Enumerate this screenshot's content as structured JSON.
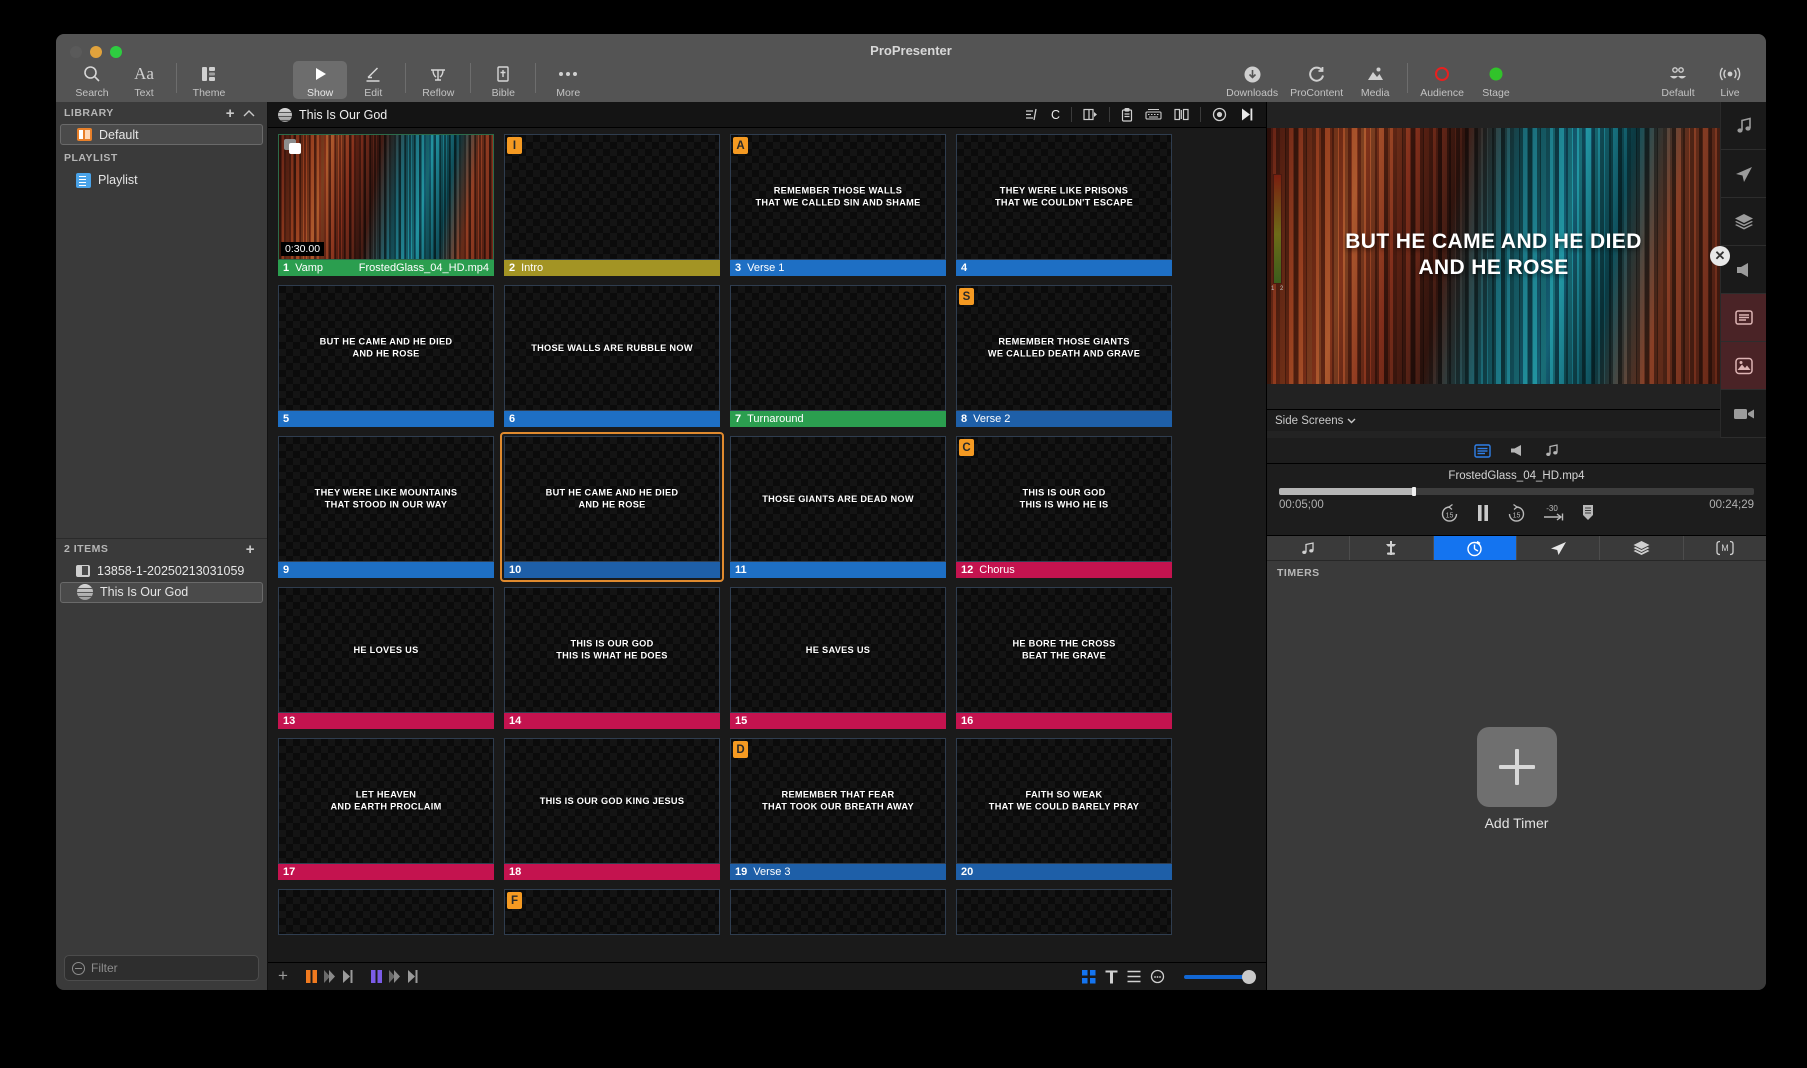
{
  "window": {
    "title": "ProPresenter"
  },
  "toolbar": {
    "left": [
      {
        "name": "search",
        "label": "Search",
        "icon": "search-icon"
      },
      {
        "name": "text",
        "label": "Text",
        "icon": "text-icon"
      },
      {
        "name": "theme",
        "label": "Theme",
        "icon": "theme-icon"
      }
    ],
    "center": [
      {
        "name": "show",
        "label": "Show",
        "icon": "play-icon",
        "active": true
      },
      {
        "name": "edit",
        "label": "Edit",
        "icon": "pencil-icon"
      },
      {
        "name": "reflow",
        "label": "Reflow",
        "icon": "reflow-icon"
      },
      {
        "name": "bible",
        "label": "Bible",
        "icon": "bible-icon"
      },
      {
        "name": "more",
        "label": "More",
        "icon": "ellipsis-icon"
      }
    ],
    "right": [
      {
        "name": "downloads",
        "label": "Downloads",
        "icon": "download-icon"
      },
      {
        "name": "procontent",
        "label": "ProContent",
        "icon": "refresh-icon"
      },
      {
        "name": "media",
        "label": "Media",
        "icon": "image-icon"
      },
      {
        "name": "audience",
        "label": "Audience",
        "icon": "circle-outline-icon"
      },
      {
        "name": "stage",
        "label": "Stage",
        "icon": "circle-filled-icon"
      }
    ],
    "far_right": [
      {
        "name": "default",
        "label": "Default",
        "icon": "mustache-icon"
      },
      {
        "name": "live",
        "label": "Live",
        "icon": "broadcast-icon"
      }
    ]
  },
  "sidebar": {
    "library_header": "LIBRARY",
    "library_items": [
      {
        "label": "Default",
        "selected": true
      }
    ],
    "playlist_header": "PLAYLIST",
    "playlist_items": [
      {
        "label": "Playlist",
        "selected": false
      }
    ],
    "items_header": "2 ITEMS",
    "items": [
      {
        "label": "13858-1-20250213031059",
        "icon": "document-icon",
        "selected": false
      },
      {
        "label": "This Is Our God",
        "icon": "globe-icon",
        "selected": true
      }
    ],
    "filter_placeholder": "Filter"
  },
  "presentation": {
    "title": "This Is Our God",
    "header_label": "C"
  },
  "slides": [
    {
      "num": "1",
      "name": "Vamp",
      "file": "FrostedGlass_04_HD.mp4",
      "label_color": "#2b9e4f",
      "media": true,
      "duration": "0:30.00",
      "text": "",
      "badge": "",
      "selected": false
    },
    {
      "num": "2",
      "name": "Intro",
      "file": "",
      "label_color": "#a39424",
      "media": false,
      "text": "",
      "badge": "I",
      "selected": false
    },
    {
      "num": "3",
      "name": "Verse 1",
      "file": "",
      "label_color": "#1e6fc4",
      "media": false,
      "text": "REMEMBER THOSE WALLS\nTHAT WE CALLED SIN AND SHAME",
      "badge": "A",
      "selected": false
    },
    {
      "num": "4",
      "name": "",
      "file": "",
      "label_color": "#1e6fc4",
      "media": false,
      "text": "THEY WERE LIKE PRISONS\nTHAT WE COULDN'T ESCAPE",
      "badge": "",
      "selected": false
    },
    {
      "num": "5",
      "name": "",
      "file": "",
      "label_color": "#1e6fc4",
      "media": false,
      "text": "BUT HE CAME AND HE DIED\nAND HE ROSE",
      "badge": "",
      "selected": false
    },
    {
      "num": "6",
      "name": "",
      "file": "",
      "label_color": "#1e6fc4",
      "media": false,
      "text": "THOSE WALLS ARE RUBBLE NOW",
      "badge": "",
      "selected": false
    },
    {
      "num": "7",
      "name": "Turnaround",
      "file": "",
      "label_color": "#2b9e4f",
      "media": false,
      "text": "",
      "badge": "",
      "selected": false
    },
    {
      "num": "8",
      "name": "Verse 2",
      "file": "",
      "label_color": "#1e5fa8",
      "media": false,
      "text": "REMEMBER THOSE GIANTS\nWE CALLED DEATH AND GRAVE",
      "badge": "S",
      "selected": false
    },
    {
      "num": "9",
      "name": "",
      "file": "",
      "label_color": "#1e6fc4",
      "media": false,
      "text": "THEY WERE LIKE MOUNTAINS\nTHAT STOOD IN OUR WAY",
      "badge": "",
      "selected": false
    },
    {
      "num": "10",
      "name": "",
      "file": "",
      "label_color": "#1e5fa8",
      "media": false,
      "text": "BUT HE CAME AND HE DIED\nAND HE ROSE",
      "badge": "",
      "selected": true
    },
    {
      "num": "11",
      "name": "",
      "file": "",
      "label_color": "#1e6fc4",
      "media": false,
      "text": "THOSE GIANTS ARE DEAD NOW",
      "badge": "",
      "selected": false
    },
    {
      "num": "12",
      "name": "Chorus",
      "file": "",
      "label_color": "#c4134f",
      "media": false,
      "text": "THIS IS OUR GOD\nTHIS IS WHO HE IS",
      "badge": "C",
      "selected": false
    },
    {
      "num": "13",
      "name": "",
      "file": "",
      "label_color": "#c4134f",
      "media": false,
      "text": "HE LOVES US",
      "badge": "",
      "selected": false
    },
    {
      "num": "14",
      "name": "",
      "file": "",
      "label_color": "#c4134f",
      "media": false,
      "text": "THIS IS OUR GOD\nTHIS IS WHAT HE DOES",
      "badge": "",
      "selected": false
    },
    {
      "num": "15",
      "name": "",
      "file": "",
      "label_color": "#c4134f",
      "media": false,
      "text": "HE SAVES US",
      "badge": "",
      "selected": false
    },
    {
      "num": "16",
      "name": "",
      "file": "",
      "label_color": "#c4134f",
      "media": false,
      "text": "HE BORE THE CROSS\nBEAT THE GRAVE",
      "badge": "",
      "selected": false
    },
    {
      "num": "17",
      "name": "",
      "file": "",
      "label_color": "#c4134f",
      "media": false,
      "text": "LET HEAVEN\nAND EARTH PROCLAIM",
      "badge": "",
      "selected": false
    },
    {
      "num": "18",
      "name": "",
      "file": "",
      "label_color": "#c4134f",
      "media": false,
      "text": "THIS IS OUR GOD KING JESUS",
      "badge": "",
      "selected": false
    },
    {
      "num": "19",
      "name": "Verse 3",
      "file": "",
      "label_color": "#1e5fa8",
      "media": false,
      "text": "REMEMBER THAT FEAR\nTHAT TOOK OUR BREATH AWAY",
      "badge": "D",
      "selected": false
    },
    {
      "num": "20",
      "name": "",
      "file": "",
      "label_color": "#1e5fa8",
      "media": false,
      "text": "FAITH SO WEAK\nTHAT WE COULD BARELY PRAY",
      "badge": "",
      "selected": false
    }
  ],
  "partial_slides": [
    {
      "badge": ""
    },
    {
      "badge": "F"
    },
    {
      "badge": ""
    },
    {
      "badge": ""
    }
  ],
  "preview": {
    "text": "BUT HE CAME AND HE DIED\nAND HE ROSE",
    "side_screens_label": "Side Screens",
    "close_icon": "close-icon"
  },
  "media_tabs": [
    {
      "name": "props-tab",
      "icon": "lines-icon",
      "active": true
    },
    {
      "name": "announcement-tab",
      "icon": "megaphone-icon",
      "active": false
    },
    {
      "name": "audio-tab",
      "icon": "music-note-icon",
      "active": false
    }
  ],
  "player": {
    "filename": "FrostedGlass_04_HD.mp4",
    "elapsed": "00:05;00",
    "remaining": "00:24;29",
    "progress_percent": 28,
    "controls": [
      {
        "name": "rewind-15-button",
        "label": "15"
      },
      {
        "name": "pause-button",
        "label": ""
      },
      {
        "name": "forward-15-button",
        "label": "15"
      },
      {
        "name": "go-to-end-minus-30-button",
        "label": "-30"
      },
      {
        "name": "marker-button",
        "label": ""
      }
    ]
  },
  "panel_tabs": [
    {
      "name": "tab-audio",
      "icon": "music-note-icon",
      "active": false
    },
    {
      "name": "tab-props",
      "icon": "prop-icon",
      "active": false
    },
    {
      "name": "tab-timers",
      "icon": "timer-icon",
      "active": true
    },
    {
      "name": "tab-messages",
      "icon": "paper-plane-icon",
      "active": false
    },
    {
      "name": "tab-layers",
      "icon": "layers-icon",
      "active": false
    },
    {
      "name": "tab-macros",
      "icon": "macro-icon",
      "active": false
    }
  ],
  "timers": {
    "header": "TIMERS",
    "add_label": "Add Timer"
  },
  "icon_rail": [
    {
      "name": "rail-audio",
      "icon": "music-note-icon",
      "highlighted": false
    },
    {
      "name": "rail-messages",
      "icon": "paper-plane-icon",
      "highlighted": false
    },
    {
      "name": "rail-layers",
      "icon": "layers-icon",
      "highlighted": false
    },
    {
      "name": "rail-announcements",
      "icon": "megaphone-icon",
      "highlighted": false
    },
    {
      "name": "rail-props",
      "icon": "lines-box-icon",
      "highlighted": true
    },
    {
      "name": "rail-media",
      "icon": "image-icon",
      "highlighted": true
    },
    {
      "name": "rail-video",
      "icon": "video-camera-icon",
      "highlighted": false
    }
  ],
  "center_header_icons": [
    {
      "name": "arrangement-icon"
    },
    {
      "name": "group-icon"
    },
    {
      "name": "clipboard-icon"
    },
    {
      "name": "keyboard-icon"
    },
    {
      "name": "compare-icon"
    },
    {
      "name": "target-icon"
    },
    {
      "name": "next-icon"
    }
  ],
  "footer": {
    "view_grid": "grid-view-icon",
    "view_text": "text-view-icon",
    "view_list": "list-view-icon",
    "view_options": "options-icon",
    "zoom_percent": 85
  },
  "colors": {
    "accent_blue": "#1474f0",
    "selection_orange": "#e08a2e",
    "green_label": "#2b9e4f",
    "pink_label": "#c4134f",
    "olive_label": "#a39424",
    "badge_orange": "#f59a22"
  }
}
